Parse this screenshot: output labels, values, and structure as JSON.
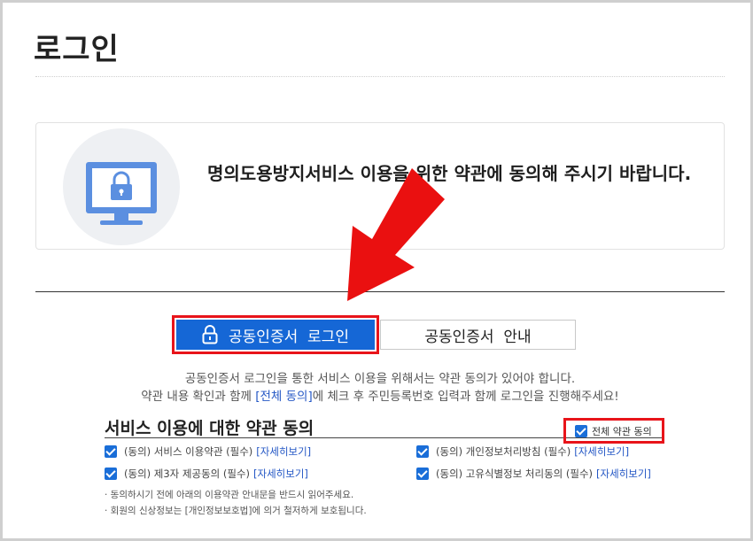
{
  "page": {
    "title": "로그인"
  },
  "notice": {
    "message": "명의도용방지서비스 이용을 위한 약관에 동의해 주시기 바랍니다."
  },
  "buttons": {
    "cert_login": "공동인증서  로그인",
    "cert_guide": "공동인증서  안내"
  },
  "guide": {
    "line1": "공동인증서 로그인을 통한 서비스 이용을 위해서는 약관 동의가 있어야 합니다.",
    "line2_before": "약관 내용 확인과 함께 ",
    "line2_link": "[전체 동의]",
    "line2_after": "에 체크 후 주민등록번호 입력과 함께 로그인을 진행해주세요!"
  },
  "terms": {
    "title": "서비스 이용에 대한 약관 동의",
    "all_agree": "전체 약관 동의",
    "items": [
      {
        "label": "(동의) 서비스 이용약관 (필수)",
        "more": "[자세히보기]",
        "checked": true
      },
      {
        "label": "(동의) 개인정보처리방침 (필수)",
        "more": "[자세히보기]",
        "checked": true
      },
      {
        "label": "(동의) 제3자 제공동의 (필수)",
        "more": "[자세히보기]",
        "checked": true
      },
      {
        "label": "(동의) 고유식별정보 처리동의 (필수)",
        "more": "[자세히보기]",
        "checked": true
      }
    ],
    "notes": [
      "· 동의하시기 전에 아래의 이용약관 안내문을 반드시 읽어주세요.",
      "· 회원의 신상정보는 [개인정보보호법]에 의거 철저하게 보호됩니다."
    ]
  },
  "colors": {
    "accent_blue": "#1567d6",
    "highlight_red": "#e8141a",
    "link_blue": "#2457c5"
  },
  "icons": {
    "notice": "monitor-lock-icon",
    "button": "lock-icon",
    "pointer": "red-arrow-icon"
  }
}
